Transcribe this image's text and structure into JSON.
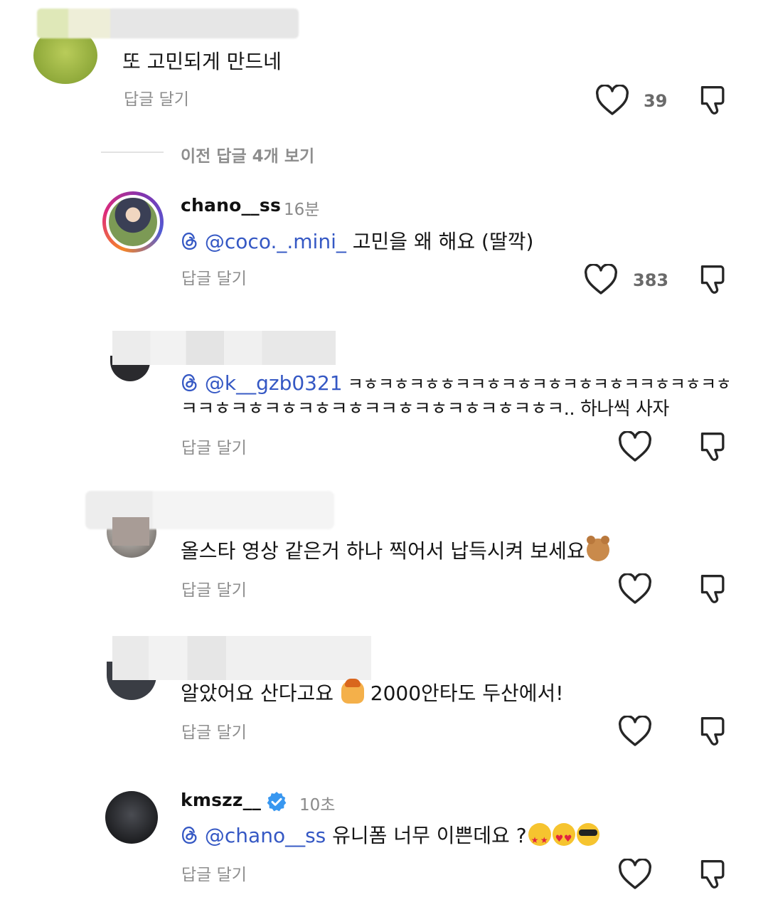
{
  "comments": [
    {
      "text": "또 고민되게 만드네",
      "reply_label": "답글 달기",
      "like_count": "39"
    },
    {
      "username": "chano__ss",
      "time": "16분",
      "mention": "@coco._.mini_",
      "text": " 고민을 왜 해요 (딸깍)",
      "reply_label": "답글 달기",
      "like_count": "383"
    },
    {
      "mention": "@k__gzb0321",
      "text_line1": " ㅋㅎㅋㅎㅋㅎㅎㅋㅋㅎㅋㅎㅋㅎㅋㅎㅋㅎㅋㅋㅎㅋㅎㅋㅎ",
      "text_line2": "ㅋㅋㅎㅋㅎㅋㅎㅋㅎㅋㅎㅋㅋㅎㅋㅎㅋㅎㅋㅎㅋㅎㅋ.. 하나씩 사자",
      "reply_label": "답글 달기"
    },
    {
      "text": "올스타 영상 같은거 하나 찍어서 납득시켜 보세요",
      "emoji": "bear-face",
      "reply_label": "답글 달기"
    },
    {
      "text_a": "알았어요 산다고요 ",
      "emoji": "person-facepalming",
      "text_b": " 2000안타도 두산에서!",
      "reply_label": "답글 달기"
    },
    {
      "username": "kmszz__",
      "time": "10초",
      "mention": "@chano__ss",
      "text": " 유니폼 너무 이쁜데요 ?",
      "emojis": [
        "star-struck",
        "heart-eyes",
        "sunglasses"
      ],
      "reply_label": "답글 달기"
    }
  ],
  "previous_replies_label": "이전 답글 4개 보기",
  "icons": {
    "threads": "threads-icon",
    "heart": "heart-outline-icon",
    "dislike": "thumbs-down-outline-icon",
    "verified": "verified-badge-icon"
  },
  "colors": {
    "mention": "#3558c4",
    "verified": "#3897f0",
    "muted": "#8e8e8e"
  }
}
